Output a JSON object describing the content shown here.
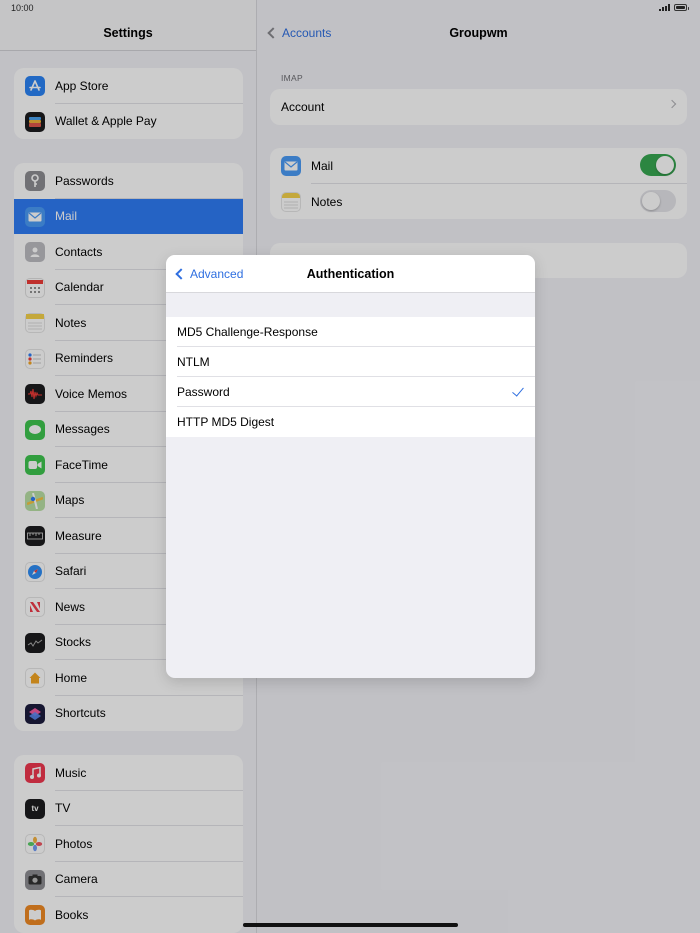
{
  "status": {
    "time": "10:00"
  },
  "sidebar": {
    "title": "Settings",
    "group1": [
      {
        "label": "App Store",
        "icon": "app-store-icon",
        "color": "#2b84f6"
      },
      {
        "label": "Wallet & Apple Pay",
        "icon": "wallet-icon",
        "color": "#1c1c1e"
      }
    ],
    "group2": [
      {
        "label": "Passwords",
        "icon": "key-icon",
        "color": "#8e8e93"
      },
      {
        "label": "Mail",
        "icon": "mail-icon",
        "color": "#2b84f6",
        "selected": true
      },
      {
        "label": "Contacts",
        "icon": "contacts-icon",
        "color": "#a4a4a9"
      },
      {
        "label": "Calendar",
        "icon": "calendar-icon",
        "color": "#ffffff"
      },
      {
        "label": "Notes",
        "icon": "notes-icon",
        "color": "#f6d34a"
      },
      {
        "label": "Reminders",
        "icon": "reminders-icon",
        "color": "#ffffff"
      },
      {
        "label": "Voice Memos",
        "icon": "voice-memos-icon",
        "color": "#1c1c1e"
      },
      {
        "label": "Messages",
        "icon": "messages-icon",
        "color": "#3fc64f"
      },
      {
        "label": "FaceTime",
        "icon": "facetime-icon",
        "color": "#3fc64f"
      },
      {
        "label": "Maps",
        "icon": "maps-icon",
        "color": "#7cc46e"
      },
      {
        "label": "Measure",
        "icon": "measure-icon",
        "color": "#1c1c1e"
      },
      {
        "label": "Safari",
        "icon": "safari-icon",
        "color": "#2b84f6"
      },
      {
        "label": "News",
        "icon": "news-icon",
        "color": "#ffffff"
      },
      {
        "label": "Stocks",
        "icon": "stocks-icon",
        "color": "#1c1c1e"
      },
      {
        "label": "Home",
        "icon": "home-icon",
        "color": "#ffffff"
      },
      {
        "label": "Shortcuts",
        "icon": "shortcuts-icon",
        "color": "#5a3fd6"
      }
    ],
    "group3": [
      {
        "label": "Music",
        "icon": "music-icon",
        "color": "#f0384f"
      },
      {
        "label": "TV",
        "icon": "tv-icon",
        "color": "#1c1c1e"
      },
      {
        "label": "Photos",
        "icon": "photos-icon",
        "color": "#ffffff"
      },
      {
        "label": "Camera",
        "icon": "camera-icon",
        "color": "#8e8e93"
      },
      {
        "label": "Books",
        "icon": "books-icon",
        "color": "#f08a24"
      }
    ]
  },
  "detail": {
    "back_label": "Accounts",
    "title": "Groupwm",
    "section_label": "IMAP",
    "account_label": "Account",
    "mail_label": "Mail",
    "notes_label": "Notes",
    "mail_on": true,
    "notes_on": false
  },
  "modal": {
    "back_label": "Advanced",
    "title": "Authentication",
    "options": [
      {
        "label": "MD5 Challenge-Response",
        "checked": false
      },
      {
        "label": "NTLM",
        "checked": false
      },
      {
        "label": "Password",
        "checked": true
      },
      {
        "label": "HTTP MD5 Digest",
        "checked": false
      }
    ]
  },
  "colors": {
    "accent": "#2f6fe0",
    "selection": "#2f7cf6",
    "toggle_on": "#38a852"
  }
}
